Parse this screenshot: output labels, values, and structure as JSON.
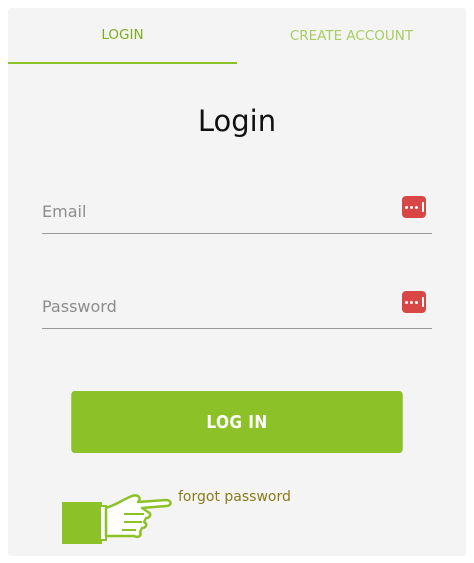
{
  "tabs": {
    "login_label": "LOGIN",
    "create_label": "CREATE ACCOUNT"
  },
  "title": "Login",
  "email": {
    "placeholder": "Email",
    "value": ""
  },
  "password": {
    "placeholder": "Password",
    "value": ""
  },
  "password_manager_icon": "password-key-icon",
  "login_button_label": "LOG IN",
  "forgot_link": "forgot password",
  "hand_icon": "pointing-hand-icon",
  "colors": {
    "accent": "#8cc227",
    "tab_active_text": "#7dae1e",
    "tab_inactive_text": "#a9cc63",
    "card_bg": "#f4f4f4",
    "key_icon_bg": "#d94646",
    "forgot_link": "#8a7a1a"
  }
}
